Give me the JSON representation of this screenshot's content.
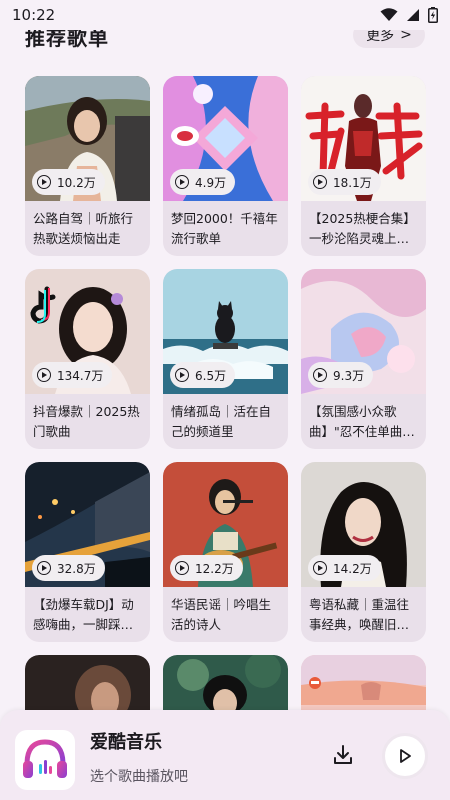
{
  "status_bar": {
    "time": "10:22"
  },
  "section": {
    "title": "推荐歌单",
    "more_label": "更多",
    "more_chevron": ">"
  },
  "playlists": [
    {
      "title": "公路自驾｜听旅行热歌送烦恼出走",
      "plays": "10.2万",
      "cover": "girl-portrait"
    },
    {
      "title": "梦回2000！千禧年流行歌单",
      "plays": "4.9万",
      "cover": "y2k-pink"
    },
    {
      "title": "【2025热梗合集】一秒沦陷灵魂上…",
      "plays": "18.1万",
      "cover": "hero-red-text"
    },
    {
      "title": "抖音爆款｜2025热门歌曲",
      "plays": "134.7万",
      "cover": "tiktok-girl"
    },
    {
      "title": "情绪孤岛｜活在自己的频道里",
      "plays": "6.5万",
      "cover": "cat-sea"
    },
    {
      "title": "【氛围感小众歌曲】\"忍不住单曲…",
      "plays": "9.3万",
      "cover": "pink-butterfly"
    },
    {
      "title": "【劲爆车载DJ】动感嗨曲，一脚踩…",
      "plays": "32.8万",
      "cover": "night-car"
    },
    {
      "title": "华语民谣｜吟唱生活的诗人",
      "plays": "12.2万",
      "cover": "guitar-boy"
    },
    {
      "title": "粤语私藏｜重温往事经典，唤醒旧…",
      "plays": "14.2万",
      "cover": "retro-actress"
    },
    {
      "title": "",
      "plays": "",
      "cover": "partial-dark"
    },
    {
      "title": "",
      "plays": "",
      "cover": "partial-green"
    },
    {
      "title": "",
      "plays": "",
      "cover": "partial-sunset"
    }
  ],
  "player": {
    "title": "爱酷音乐",
    "subtitle": "选个歌曲播放吧",
    "logo_colors": {
      "pink": "#e8489a",
      "purple": "#8a3fd1",
      "cyan": "#2fc4e6"
    }
  }
}
